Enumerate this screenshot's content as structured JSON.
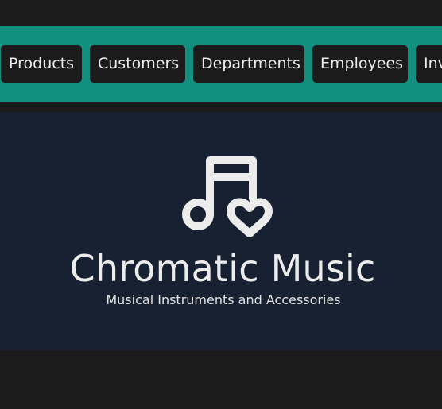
{
  "nav": {
    "items": [
      {
        "label": "Products"
      },
      {
        "label": "Customers"
      },
      {
        "label": "Departments"
      },
      {
        "label": "Employees"
      },
      {
        "label": "Inventory"
      }
    ]
  },
  "hero": {
    "logo_icon": "music-note-heart-icon",
    "title": "Chromatic Music",
    "subtitle": "Musical Instruments and Accessories"
  },
  "colors": {
    "accent": "#138f7f",
    "hero_bg": "#182132",
    "page_bg": "#1b1b1c",
    "button_bg": "#1b1b1c",
    "text": "#ececec"
  }
}
